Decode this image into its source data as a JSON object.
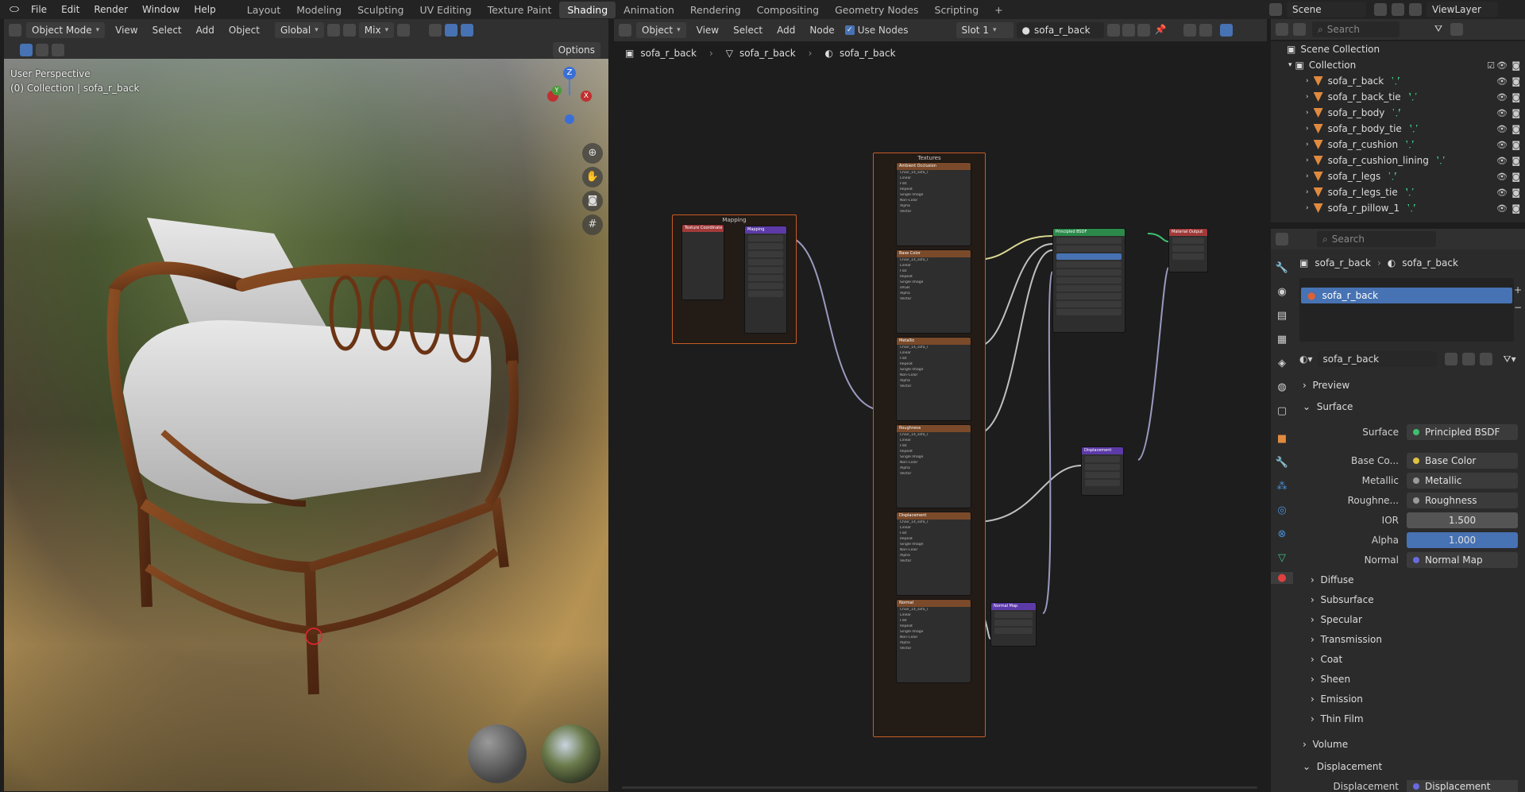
{
  "topbar": {
    "menus": [
      "File",
      "Edit",
      "Render",
      "Window",
      "Help"
    ],
    "workspaces": [
      "Layout",
      "Modeling",
      "Sculpting",
      "UV Editing",
      "Texture Paint",
      "Shading",
      "Animation",
      "Rendering",
      "Compositing",
      "Geometry Nodes",
      "Scripting"
    ],
    "active_workspace": "Shading",
    "add_workspace": "+",
    "scene": "Scene",
    "view_layer": "ViewLayer"
  },
  "viewport": {
    "mode": "Object Mode",
    "menus": [
      "View",
      "Select",
      "Add",
      "Object"
    ],
    "transform": "Global",
    "blend": "Mix",
    "options": "Options",
    "overlay_title": "User Perspective",
    "overlay_sub": "(0) Collection | sofa_r_back",
    "gizmo": {
      "z": "Z",
      "x": "X",
      "y": "Y"
    }
  },
  "node_editor": {
    "type": "Object",
    "menus": [
      "View",
      "Select",
      "Add",
      "Node"
    ],
    "use_nodes": "Use Nodes",
    "slot": "Slot 1",
    "material": "sofa_r_back",
    "breadcrumb": [
      "sofa_r_back",
      "sofa_r_back",
      "sofa_r_back"
    ],
    "frame_mapping": "Mapping",
    "frame_textures": "Textures",
    "nodes": {
      "texcoord": "Texture Coordinate",
      "mapping": "Mapping",
      "ao": "Ambient Occlusion",
      "basecolor": "Base Color",
      "metallic": "Metallic",
      "roughness": "Roughness",
      "displacement": "Displacement",
      "normal": "Normal",
      "bsdf": "Principled BSDF",
      "output": "Material Output",
      "disp_node": "Displacement",
      "normalmap": "Normal Map"
    },
    "tex_file": "Chair_14_sofa_r",
    "tex_rows": [
      "Linear",
      "Flat",
      "Repeat",
      "Single Image",
      "Color Space",
      "Alpha",
      "Vector"
    ],
    "color_space_values": [
      "Non-Color",
      "sRGB",
      "Non-Color",
      "Non-Color",
      "Non-Color",
      "Non-Color"
    ]
  },
  "outliner": {
    "search_placeholder": "Search",
    "scene_collection": "Scene Collection",
    "collection": "Collection",
    "items": [
      "sofa_r_back",
      "sofa_r_back_tie",
      "sofa_r_body",
      "sofa_r_body_tie",
      "sofa_r_cushion",
      "sofa_r_cushion_lining",
      "sofa_r_legs",
      "sofa_r_legs_tie",
      "sofa_r_pillow_1"
    ]
  },
  "properties": {
    "search_placeholder": "Search",
    "breadcrumb": [
      "sofa_r_back",
      "sofa_r_back"
    ],
    "slot_item": "sofa_r_back",
    "material_name": "sofa_r_back",
    "sections": {
      "preview": "Preview",
      "surface": "Surface",
      "volume": "Volume",
      "displacement": "Displacement"
    },
    "surface_rows": [
      {
        "label": "Surface",
        "value": "Principled BSDF",
        "color": "#3fbf6f"
      },
      {
        "label": "Base Co...",
        "value": "Base Color",
        "color": "#e0c040"
      },
      {
        "label": "Metallic",
        "value": "Metallic",
        "color": "#9a9a9a"
      },
      {
        "label": "Roughne...",
        "value": "Roughness",
        "color": "#9a9a9a"
      },
      {
        "label": "IOR",
        "value": "1.500",
        "color": "#9a9a9a"
      },
      {
        "label": "Alpha",
        "value": "1.000",
        "color": "#9a9a9a"
      },
      {
        "label": "Normal",
        "value": "Normal Map",
        "color": "#6a6ae0"
      }
    ],
    "subsections": [
      "Diffuse",
      "Subsurface",
      "Specular",
      "Transmission",
      "Coat",
      "Sheen",
      "Emission",
      "Thin Film"
    ],
    "disp_label": "Displacement",
    "disp_value": "Displacement"
  }
}
